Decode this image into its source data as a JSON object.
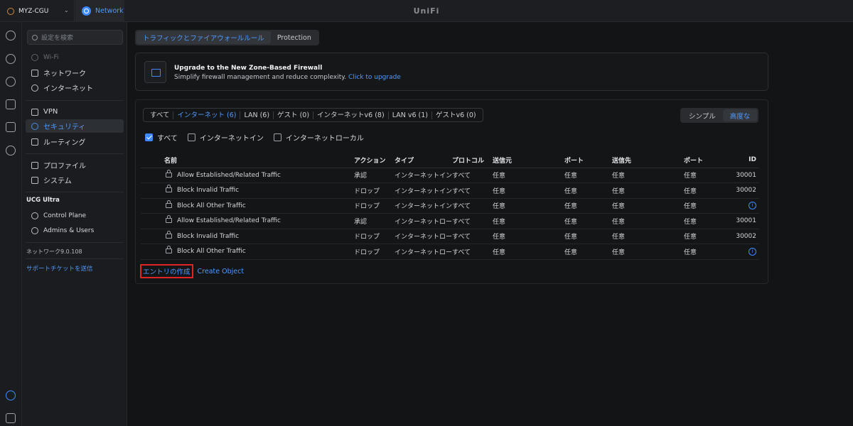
{
  "topbar": {
    "site_name": "MYZ-CGU",
    "app_label": "Network",
    "brand": "UniFi"
  },
  "sidebar": {
    "search_placeholder": "設定を検索",
    "items": [
      {
        "label": "Wi-Fi",
        "icon": "wifi-icon"
      },
      {
        "label": "ネットワーク",
        "icon": "network-icon"
      },
      {
        "label": "インターネット",
        "icon": "globe-icon"
      },
      {
        "label": "VPN",
        "icon": "vpn-icon"
      },
      {
        "label": "セキュリティ",
        "icon": "shield-icon"
      },
      {
        "label": "ルーティング",
        "icon": "routing-icon"
      },
      {
        "label": "プロファイル",
        "icon": "profile-icon"
      },
      {
        "label": "システム",
        "icon": "system-icon"
      }
    ],
    "device_heading": "UCG Ultra",
    "device_items": [
      {
        "label": "Control Plane",
        "icon": "cloud-icon"
      },
      {
        "label": "Admins & Users",
        "icon": "users-icon"
      }
    ],
    "version": "ネットワーク9.0.108",
    "support_link": "サポートチケットを送信"
  },
  "tabs": [
    {
      "label": "トラフィックとファイアウォールルール",
      "active": true
    },
    {
      "label": "Protection",
      "active": false
    }
  ],
  "banner": {
    "title": "Upgrade to the New Zone-Based Firewall",
    "text": "Simplify firewall management and reduce complexity.",
    "link": "Click to upgrade"
  },
  "filters": [
    {
      "label": "すべて",
      "active": false
    },
    {
      "label": "インターネット (6)",
      "active": true
    },
    {
      "label": "LAN (6)",
      "active": false
    },
    {
      "label": "ゲスト (0)",
      "active": false
    },
    {
      "label": "インターネットv6 (8)",
      "active": false
    },
    {
      "label": "LAN v6 (1)",
      "active": false
    },
    {
      "label": "ゲストv6 (0)",
      "active": false
    }
  ],
  "view_switch": {
    "simple": "シンプル",
    "advanced": "高度な"
  },
  "checks": [
    {
      "label": "すべて",
      "checked": true
    },
    {
      "label": "インターネットイン",
      "checked": false
    },
    {
      "label": "インターネットローカル",
      "checked": false
    }
  ],
  "table": {
    "headers": [
      "名前",
      "アクション",
      "タイプ",
      "プロトコル",
      "送信元",
      "ポート",
      "送信先",
      "ポート",
      "ID"
    ],
    "rows": [
      {
        "name": "Allow Established/Related Traffic",
        "action": "承認",
        "type": "インターネットイン",
        "protocol": "すべて",
        "src": "任意",
        "sport": "任意",
        "dst": "任意",
        "dport": "任意",
        "id": "30001"
      },
      {
        "name": "Block Invalid Traffic",
        "action": "ドロップ",
        "type": "インターネットイン",
        "protocol": "すべて",
        "src": "任意",
        "sport": "任意",
        "dst": "任意",
        "dport": "任意",
        "id": "30002"
      },
      {
        "name": "Block All Other Traffic",
        "action": "ドロップ",
        "type": "インターネットイン",
        "protocol": "すべて",
        "src": "任意",
        "sport": "任意",
        "dst": "任意",
        "dport": "任意",
        "id": ""
      },
      {
        "name": "Allow Established/Related Traffic",
        "action": "承認",
        "type": "インターネットローカル",
        "protocol": "すべて",
        "src": "任意",
        "sport": "任意",
        "dst": "任意",
        "dport": "任意",
        "id": "30001"
      },
      {
        "name": "Block Invalid Traffic",
        "action": "ドロップ",
        "type": "インターネットローカル",
        "protocol": "すべて",
        "src": "任意",
        "sport": "任意",
        "dst": "任意",
        "dport": "任意",
        "id": "30002"
      },
      {
        "name": "Block All Other Traffic",
        "action": "ドロップ",
        "type": "インターネットローカル",
        "protocol": "すべて",
        "src": "任意",
        "sport": "任意",
        "dst": "任意",
        "dport": "任意",
        "id": ""
      }
    ]
  },
  "actions": {
    "create_entry": "エントリの作成",
    "create_object": "Create Object"
  }
}
